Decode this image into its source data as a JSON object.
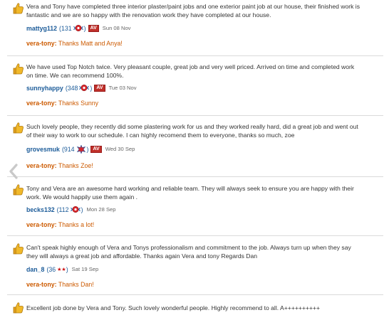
{
  "reviews": [
    {
      "comment": "Vera and Tony have completed three interior plaster/paint jobs and one exterior paint job at our house, their finished work is fantastic and we are so happy with the renovation work they have completed at our house.",
      "username": "mattyg112",
      "score_open": "(131",
      "score_close": ")",
      "badge": "rosette",
      "av": "AV",
      "date": "Sun 08 Nov",
      "reply_user": "vera-tony:",
      "reply_text": "Thanks Matt and Anya!"
    },
    {
      "comment": "We have used Top Notch twice. Very pleasant couple, great job and very well priced. Arrived on time and completed work on time. We can recommend 100%.",
      "username": "sunnyhappy",
      "score_open": "(348",
      "score_close": ")",
      "badge": "rosette",
      "av": "AV",
      "date": "Tue 03 Nov",
      "reply_user": "vera-tony:",
      "reply_text": "Thanks Sunny"
    },
    {
      "comment": "Such lovely people, they recently did some plastering work for us and they worked really hard, did a great job and went out of their way to work to our schedule. I can highly recomend them to everyone, thanks so much, zoe",
      "username": "grovesmuk",
      "score_open": "(914",
      "score_close": ")",
      "badge": "star-burst",
      "av": "AV",
      "date": "Wed 30 Sep",
      "reply_user": "vera-tony:",
      "reply_text": "Thanks Zoe!"
    },
    {
      "comment": "Tony and Vera are an awesome hard working and reliable team. They will always seek to ensure you are happy with their work. We would happily use them again .",
      "username": "becks132",
      "score_open": "(112",
      "score_close": ")",
      "badge": "rosette",
      "av": "",
      "date": "Mon 28 Sep",
      "reply_user": "vera-tony:",
      "reply_text": "Thanks a lot!"
    },
    {
      "comment": "Can't speak highly enough of Vera and Tonys professionalism and commitment to the job. Always turn up when they say they will always a great job and affordable. Thanks again Vera and tony Regards Dan",
      "username": "dan_8",
      "score_open": "(36",
      "score_close": ")",
      "badge": "two-stars",
      "av": "",
      "date": "Sat 19 Sep",
      "reply_user": "vera-tony:",
      "reply_text": "Thanks Dan!"
    },
    {
      "comment": "Excellent job done by Vera and Tony. Such lovely wonderful people. Highly recommend to all. A++++++++++"
    }
  ],
  "colors": {
    "username": "#1b5b99",
    "reply": "#cc5a00",
    "av_badge": "#c0302a",
    "divider": "#dadada"
  },
  "icons": {
    "thumb": "thumbs-up-icon",
    "nav": "chevron-left-icon"
  }
}
